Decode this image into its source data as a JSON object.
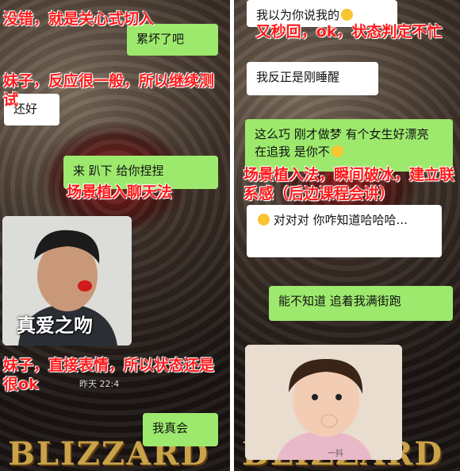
{
  "left": {
    "bubbles": [
      {
        "side": "out",
        "text": "累坏了吧"
      },
      {
        "side": "in",
        "text": "还好"
      },
      {
        "side": "out",
        "text": "来 趴下 给你捏捏"
      },
      {
        "side": "out",
        "text": "我真会"
      }
    ],
    "annotations": [
      "没错，就是关心式切入",
      "妹子，反应很一般，所以继续测试",
      "场景植入聊天法",
      "妹子，直接表情，所以状态还是很ok"
    ],
    "sticker_caption": "真爱之吻",
    "timestamp": "昨天 22:4",
    "bg_logo": "BLIZZARD"
  },
  "right": {
    "bubbles": [
      {
        "side": "in",
        "text": "我以为你说我的"
      },
      {
        "side": "in",
        "text": "我反正是刚睡醒"
      },
      {
        "side": "out",
        "text": "这么巧 刚才做梦 有个女生好漂亮 在追我 是你不"
      },
      {
        "side": "in",
        "text": "对对对 你咋知道哈哈哈..."
      },
      {
        "side": "out",
        "text": "能不知道 追着我满街跑"
      }
    ],
    "annotations": [
      "又秒回，ok，状态判定不忙",
      "场景植入法，瞬间破冰，建立联系感（后边课程会讲）"
    ],
    "sticker_caption": "一抖",
    "bg_logo": "BLIZZARD"
  }
}
